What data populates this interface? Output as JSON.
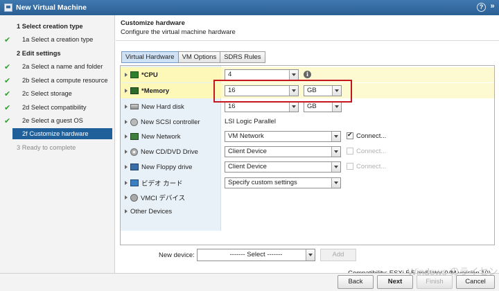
{
  "window": {
    "title": "New Virtual Machine",
    "help": "?",
    "expand": "»"
  },
  "nav": {
    "steps": [
      {
        "label": "1  Select creation type",
        "kind": "head",
        "checked": false
      },
      {
        "label": "1a  Select a creation type",
        "kind": "sub",
        "checked": true
      },
      {
        "label": "2  Edit settings",
        "kind": "head",
        "checked": false
      },
      {
        "label": "2a  Select a name and folder",
        "kind": "sub",
        "checked": true
      },
      {
        "label": "2b  Select a compute resource",
        "kind": "sub",
        "checked": true
      },
      {
        "label": "2c  Select storage",
        "kind": "sub",
        "checked": true
      },
      {
        "label": "2d  Select compatibility",
        "kind": "sub",
        "checked": true
      },
      {
        "label": "2e  Select a guest OS",
        "kind": "sub",
        "checked": true
      },
      {
        "label": "2f  Customize hardware",
        "kind": "active",
        "checked": false
      },
      {
        "label": "3  Ready to complete",
        "kind": "disabled",
        "checked": false
      }
    ],
    "check_glyph": "✔"
  },
  "header": {
    "title": "Customize hardware",
    "subtitle": "Configure the virtual machine hardware"
  },
  "tabs": [
    "Virtual Hardware",
    "VM Options",
    "SDRS Rules"
  ],
  "hardware": {
    "cpu": {
      "label": "*CPU",
      "value": "4",
      "info": "i"
    },
    "memory": {
      "label": "*Memory",
      "value": "16",
      "unit": "GB"
    },
    "disk": {
      "label": "New Hard disk",
      "value": "16",
      "unit": "GB"
    },
    "scsi": {
      "label": "New SCSI controller",
      "value": "LSI Logic Parallel"
    },
    "network": {
      "label": "New Network",
      "value": "VM Network",
      "connect": "Connect...",
      "connected": true
    },
    "cd": {
      "label": "New CD/DVD Drive",
      "value": "Client Device",
      "connect": "Connect..."
    },
    "floppy": {
      "label": "New Floppy drive",
      "value": "Client Device",
      "connect": "Connect..."
    },
    "video": {
      "label": "ビデオ カード",
      "value": "Specify custom settings"
    },
    "vmci": {
      "label": "VMCI デバイス"
    },
    "other": {
      "label": "Other Devices"
    }
  },
  "new_device": {
    "label": "New device:",
    "select": "------- Select -------",
    "add": "Add"
  },
  "compatibility": "Compatibility: ESXi 5.5 and later (VM version 10)",
  "footer": {
    "back": "Back",
    "next": "Next",
    "finish": "Finish",
    "cancel": "Cancel"
  },
  "watermark": "Windows のライセンス"
}
